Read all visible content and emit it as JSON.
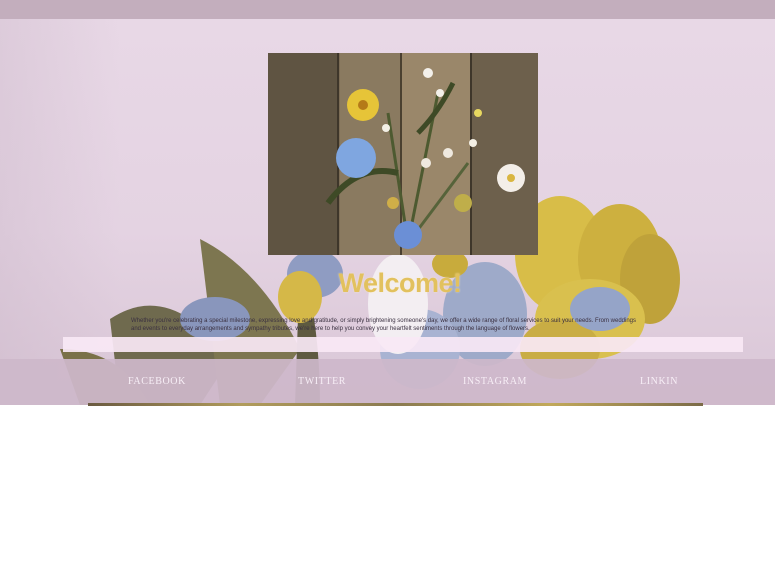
{
  "hero": {
    "heading": "Welcome!",
    "intro_line1": "Whether you're celebrating a special milestone, expressing love and gratitude, or simply brightening someone's day, we offer a wide range of floral services to suit your needs. From weddings",
    "intro_line2": "and events to everyday arrangements and sympathy tributes, we're here to help you convey your heartfelt sentiments through the language of flowers."
  },
  "social": {
    "links": [
      {
        "label": "FACEBOOK"
      },
      {
        "label": "TWITTER"
      },
      {
        "label": "INSTAGRAM"
      },
      {
        "label": "LINKIN"
      }
    ]
  },
  "colors": {
    "top_bar": "#c3aebd",
    "heading": "#e2c15e",
    "social_bar": "#cdb8ca",
    "social_text": "#f7eef6"
  }
}
